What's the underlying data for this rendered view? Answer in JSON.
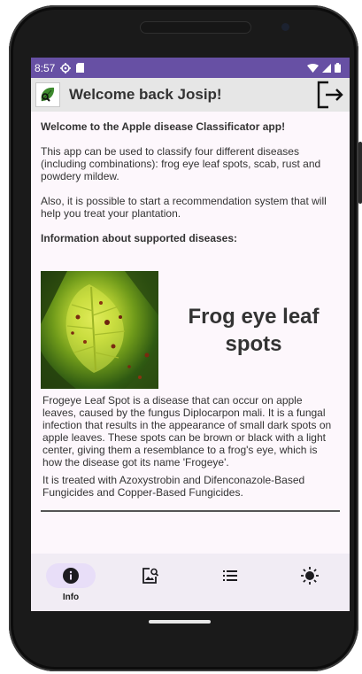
{
  "status_bar": {
    "time": "8:57"
  },
  "app_bar": {
    "title": "Welcome back Josip!"
  },
  "content": {
    "heading": "Welcome to the Apple disease Classificator app!",
    "intro": "This app can be used to classify four different diseases (including combinations): frog eye leaf spots, scab, rust and powdery mildew.",
    "recommendation": "Also, it is possible to start a recommendation system that will help you treat your plantation.",
    "info_heading": "Information about supported diseases:",
    "disease": {
      "title": "Frog eye leaf spots",
      "description": "Frogeye Leaf Spot is a disease that can occur on apple leaves, caused by the fungus Diplocarpon mali. It is a fungal infection that results in the appearance of small dark spots on apple leaves. These spots can be brown or black with a light center, giving them a resemblance to a frog's eye, which is how the disease got its name 'Frogeye'.",
      "treatment": "It is treated with Azoxystrobin and Difenconazole-Based Fungicides and Copper-Based Fungicides."
    }
  },
  "bottom_nav": {
    "items": [
      {
        "label": "Info",
        "icon": "info-icon",
        "active": true
      },
      {
        "label": "",
        "icon": "image-search-icon",
        "active": false
      },
      {
        "label": "",
        "icon": "list-icon",
        "active": false
      },
      {
        "label": "",
        "icon": "brightness-icon",
        "active": false
      }
    ]
  },
  "colors": {
    "status_bar": "#6750a4",
    "app_bar": "#e6e6e6",
    "nav_active_pill": "#e8def8",
    "screen_bg": "#fdf7fc"
  }
}
